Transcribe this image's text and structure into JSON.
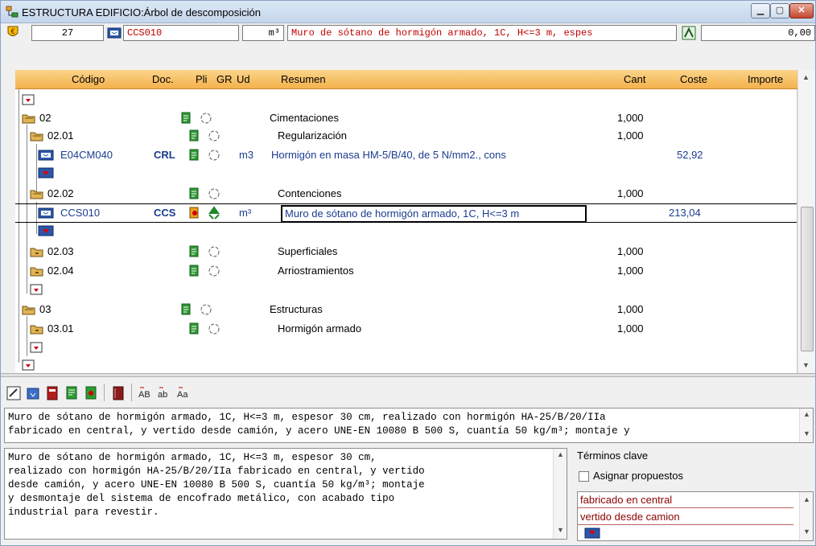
{
  "window": {
    "title": "ESTRUCTURA EDIFICIO:Árbol de descomposición",
    "controls": [
      "minimize",
      "maximize",
      "close"
    ]
  },
  "toolbar": {
    "number": "27",
    "code": "CCS010",
    "unit": "m³",
    "summary": "Muro de sótano de hormigón armado, 1C, H<=3 m, espes",
    "value": "0,00"
  },
  "grid": {
    "columns": [
      "Código",
      "Doc.",
      "Pli",
      "GR",
      "Ud",
      "Resumen",
      "Cant",
      "Coste",
      "Importe"
    ],
    "rows": [
      {
        "code": "02",
        "doc": "",
        "ud": "",
        "resumen": "Cimentaciones",
        "cant": "1,000",
        "coste": "",
        "type": "chapter"
      },
      {
        "code": "02.01",
        "doc": "",
        "ud": "",
        "resumen": "Regularización",
        "cant": "1,000",
        "coste": "",
        "type": "subchapter"
      },
      {
        "code": "E04CM040",
        "doc": "CRL",
        "ud": "m3",
        "resumen": "Hormigón en masa HM-5/B/40, de 5 N/mm2., cons",
        "cant": "",
        "coste": "52,92",
        "type": "item"
      },
      {
        "code": "02.02",
        "doc": "",
        "ud": "",
        "resumen": "Contenciones",
        "cant": "1,000",
        "coste": "",
        "type": "subchapter"
      },
      {
        "code": "CCS010",
        "doc": "CCS",
        "ud": "m³",
        "resumen": "Muro de sótano de hormigón armado, 1C, H<=3 m",
        "cant": "",
        "coste": "213,04",
        "type": "item-selected"
      },
      {
        "code": "02.03",
        "doc": "",
        "ud": "",
        "resumen": "Superficiales",
        "cant": "1,000",
        "coste": "",
        "type": "subchapter"
      },
      {
        "code": "02.04",
        "doc": "",
        "ud": "",
        "resumen": "Arriostramientos",
        "cant": "1,000",
        "coste": "",
        "type": "subchapter"
      },
      {
        "code": "03",
        "doc": "",
        "ud": "",
        "resumen": "Estructuras",
        "cant": "1,000",
        "coste": "",
        "type": "chapter"
      },
      {
        "code": "03.01",
        "doc": "",
        "ud": "",
        "resumen": "Hormigón armado",
        "cant": "1,000",
        "coste": "",
        "type": "subchapter"
      }
    ]
  },
  "short_text": "Muro de sótano de hormigón armado, 1C, H<=3 m, espesor 30 cm, realizado con hormigón HA-25/B/20/IIa\nfabricado en central, y vertido desde camión, y acero UNE-EN 10080 B 500 S, cuantía 50 kg/m³; montaje y",
  "long_text": "Muro de sótano de hormigón armado, 1C, H<=3 m, espesor 30 cm,\nrealizado con hormigón HA-25/B/20/IIa fabricado en central, y vertido\ndesde camión, y acero UNE-EN 10080 B 500 S, cuantía 50 kg/m³; montaje\ny desmontaje del sistema de encofrado metálico, con acabado tipo\nindustrial para revestir.",
  "keywords": {
    "title": "Términos clave",
    "assign_label": "Asignar propuestos",
    "items": [
      "fabricado en central",
      "vertido desde camion"
    ]
  },
  "colors": {
    "header": "#f4b24c",
    "code_blue": "#1a3c8f",
    "keyword_red": "#8b0000",
    "icon_green": "#1f8a2a"
  }
}
